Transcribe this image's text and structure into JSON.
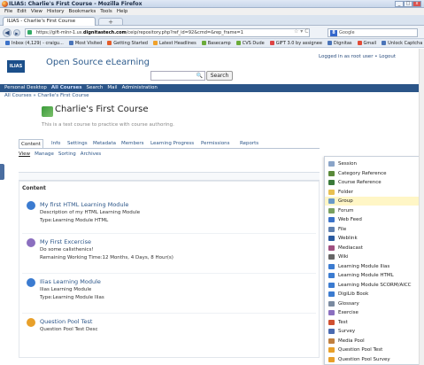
{
  "window": {
    "title": "ILIAS: Charlie's First Course - Mozilla Firefox",
    "controls": [
      "_",
      "□",
      "x"
    ]
  },
  "menubar": [
    "File",
    "Edit",
    "View",
    "History",
    "Bookmarks",
    "Tools",
    "Help"
  ],
  "browser_tab": {
    "label": "ILIAS - Charlie's First Course",
    "new_tab": "+"
  },
  "navbar": {
    "url_prefix": "https://gift-mlnr-1.us.",
    "url_domain": "dignitastech.com",
    "url_suffix": "/ceip/repository.php?ref_id=92&cmd=&rep_frame=1",
    "star": "☆ ▾ C",
    "search_placeholder": "Google"
  },
  "bookmarks": [
    {
      "label": "Inbox (4,129) - craigu...",
      "color": "#3b72c9"
    },
    {
      "label": "Most Visited",
      "color": "#4a74b8"
    },
    {
      "label": "Getting Started",
      "color": "#e35d2a"
    },
    {
      "label": "Latest Headlines",
      "color": "#f0a12b"
    },
    {
      "label": "Basecamp",
      "color": "#6bab3a"
    },
    {
      "label": "CVS Dude",
      "color": "#6bab3a"
    },
    {
      "label": "GIFT 3.0 by assignee",
      "color": "#d44"
    },
    {
      "label": "Dignitas",
      "color": "#4a74b8"
    },
    {
      "label": "Gmail",
      "color": "#e04b36"
    },
    {
      "label": "Unlock Captcha",
      "color": "#4a74b8"
    }
  ],
  "header": {
    "logo": "ILIAS",
    "brand": "Open Source eLearning",
    "search_button": "Search",
    "logged_in": "Logged in as root user • Logout"
  },
  "mainnav": {
    "items": [
      "Personal Desktop",
      "All Courses",
      "Search",
      "Mail",
      "Administration"
    ],
    "active": "All Courses"
  },
  "breadcrumb": "All Courses » Charlie's First Course",
  "page": {
    "title": "Charlie's First Course",
    "description": "This is a test course to practice with course authoring."
  },
  "tabs": [
    "Content",
    "Info",
    "Settings",
    "Metadata",
    "Members",
    "Learning Progress",
    "Permissions",
    "Reports"
  ],
  "selected_tab": "Content",
  "subtabs": [
    "View",
    "Manage",
    "Sorting",
    "Archives"
  ],
  "selected_subtab": "View",
  "content": {
    "heading": "Content",
    "items": [
      {
        "title": "My first HTML Learning Module",
        "lines": [
          "Description of my HTML Learning Module",
          "Type:Learning Module HTML"
        ],
        "color": "#3b7bd0"
      },
      {
        "title": "My First Excercise",
        "lines": [
          "Do some calisthenics!",
          "Remaining Working Time:12 Months, 4 Days, 8 Hour(s)"
        ],
        "color": "#8b6fbf"
      },
      {
        "title": "Ilias Learning Module",
        "lines": [
          "Ilias Learning Module",
          "Type:Learning Module Ilias"
        ],
        "color": "#3b7bd0"
      },
      {
        "title": "Question Pool Test",
        "lines": [
          "Question Pool Test Desc"
        ],
        "color": "#e8a02a"
      }
    ]
  },
  "add_menu": {
    "highlighted": "Group",
    "items": [
      {
        "label": "Session",
        "color": "#8aa4c8"
      },
      {
        "label": "Category Reference",
        "color": "#5a8a3a"
      },
      {
        "label": "Course Reference",
        "color": "#3a7a3a"
      },
      {
        "label": "Folder",
        "color": "#e8c050"
      },
      {
        "label": "Group",
        "color": "#6a9ac8"
      },
      {
        "label": "Forum",
        "color": "#7aa060"
      },
      {
        "label": "Web Feed",
        "color": "#3b72c9"
      },
      {
        "label": "File",
        "color": "#5d7fb0"
      },
      {
        "label": "Weblink",
        "color": "#2a5aa0"
      },
      {
        "label": "Mediacast",
        "color": "#a05080"
      },
      {
        "label": "Wiki",
        "color": "#666"
      },
      {
        "label": "Learning Module Ilias",
        "color": "#3b7bd0"
      },
      {
        "label": "Learning Module HTML",
        "color": "#3b7bd0"
      },
      {
        "label": "Learning Module SCORM/AICC",
        "color": "#3b7bd0"
      },
      {
        "label": "DigiLib Book",
        "color": "#3b7bd0"
      },
      {
        "label": "Glossary",
        "color": "#7a8aa0"
      },
      {
        "label": "Exercise",
        "color": "#8b6fbf"
      },
      {
        "label": "Test",
        "color": "#d05030"
      },
      {
        "label": "Survey",
        "color": "#4a6ab0"
      },
      {
        "label": "Media Pool",
        "color": "#c08040"
      },
      {
        "label": "Question Pool Test",
        "color": "#e8a02a"
      },
      {
        "label": "Question Pool Survey",
        "color": "#e8a02a"
      }
    ]
  }
}
